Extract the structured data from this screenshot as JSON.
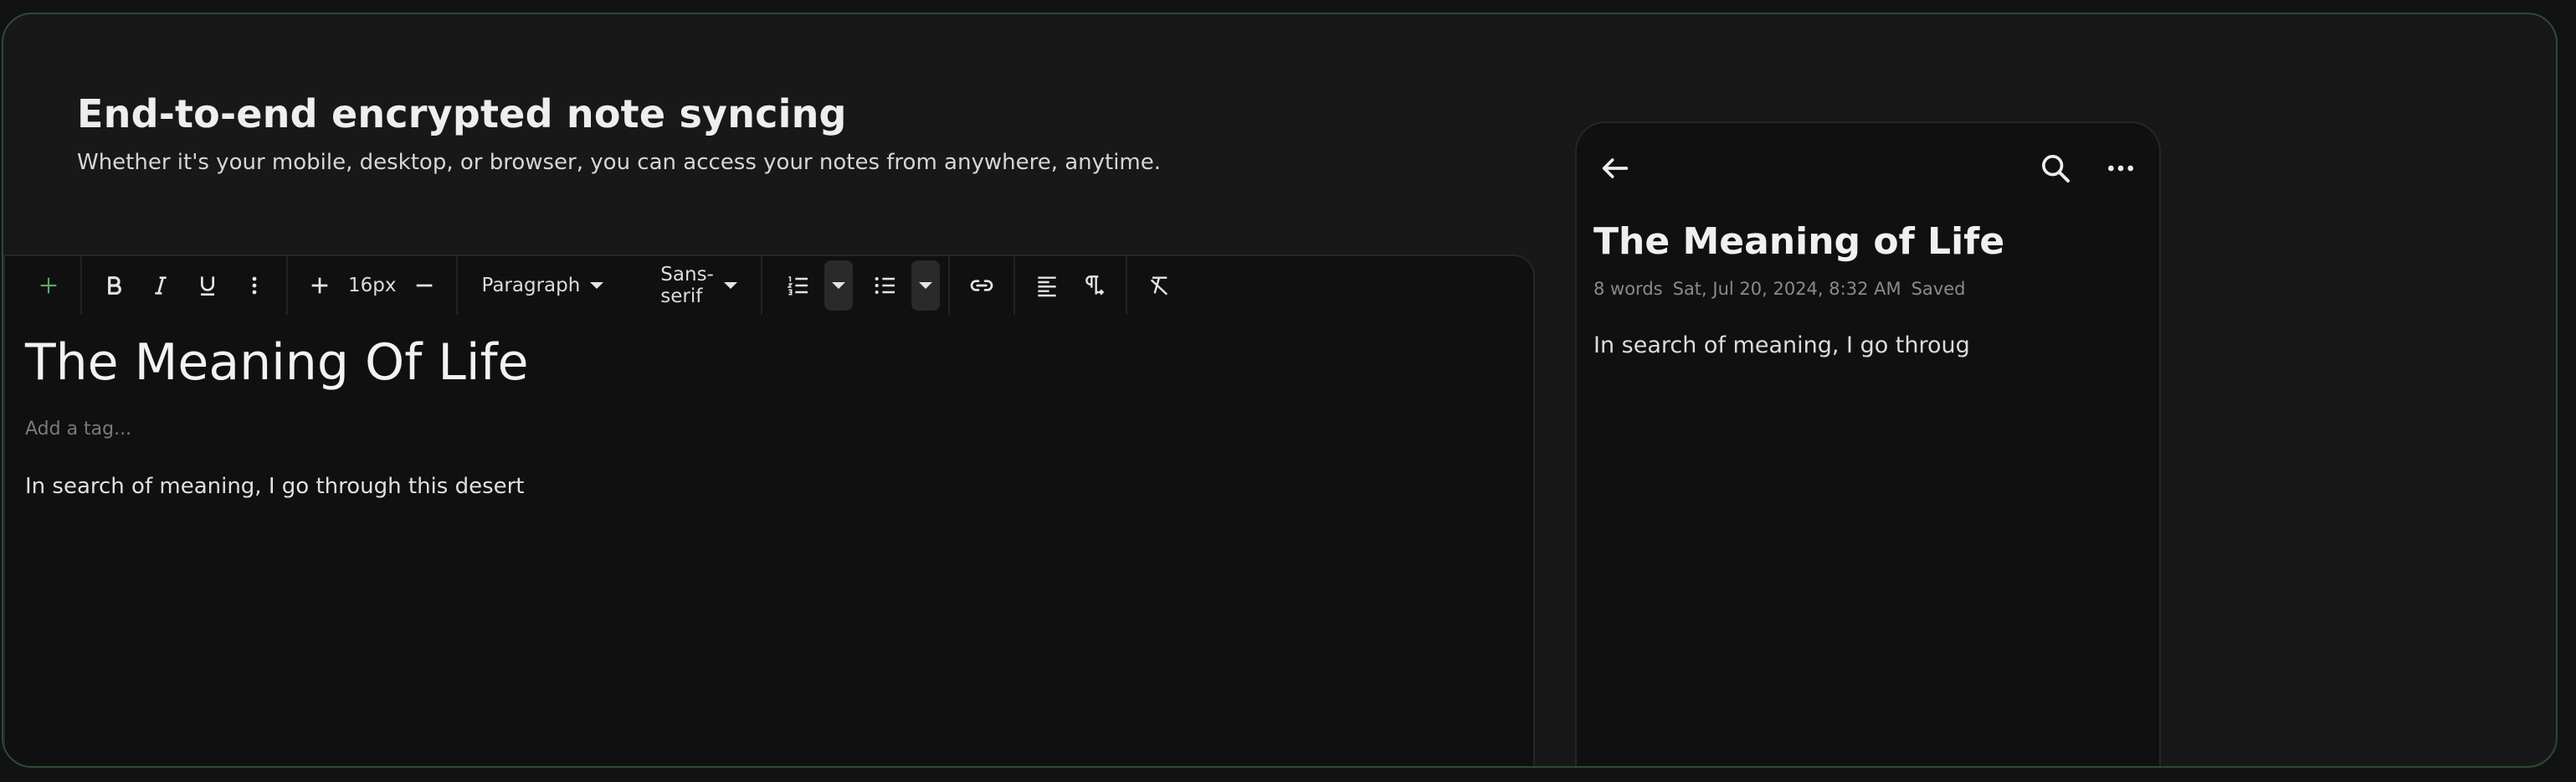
{
  "hero": {
    "title": "End-to-end encrypted note syncing",
    "subtitle": "Whether it's your mobile, desktop, or browser, you can access your notes from anywhere, anytime."
  },
  "toolbar": {
    "font_size": "16px",
    "block_type": "Paragraph",
    "font_family": "Sans-serif"
  },
  "editor": {
    "title": "The Meaning Of Life",
    "tag_placeholder": "Add a tag...",
    "body": "In search of meaning, I go through this desert"
  },
  "mobile": {
    "title": "The Meaning of Life",
    "meta": {
      "word_count": "8 words",
      "date": "Sat, Jul 20, 2024, 8:32 AM",
      "status": "Saved"
    },
    "body": "In search of meaning, I go throug"
  },
  "colors": {
    "accent_green": "#5aa863",
    "frame_border": "#2f4a32",
    "background": "#181818",
    "editor_bg": "#101010"
  }
}
